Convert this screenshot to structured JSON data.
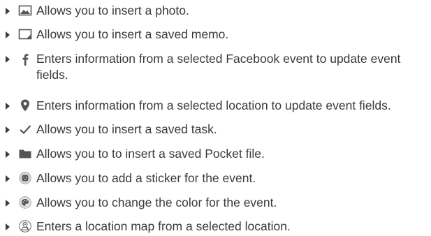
{
  "items": [
    {
      "icon": "photo-icon",
      "text": "Allows you to insert a photo."
    },
    {
      "icon": "memo-icon",
      "text": "Allows you to insert a saved memo."
    },
    {
      "icon": "facebook-icon",
      "text": "Enters information from a selected Facebook event to update event",
      "text2": "fields."
    },
    {
      "icon": "location-pin-icon",
      "text": "Enters information from a selected location to update event fields."
    },
    {
      "icon": "checkmark-icon",
      "text": "Allows you to insert a saved task."
    },
    {
      "icon": "folder-icon",
      "text": "Allows you to to insert a saved Pocket file."
    },
    {
      "icon": "sticker-icon",
      "text": "Allows you to add a sticker for the event."
    },
    {
      "icon": "palette-icon",
      "text": "Allows you to change the color for the event."
    },
    {
      "icon": "location-map-icon",
      "text": "Enters a location map from a selected location."
    }
  ]
}
